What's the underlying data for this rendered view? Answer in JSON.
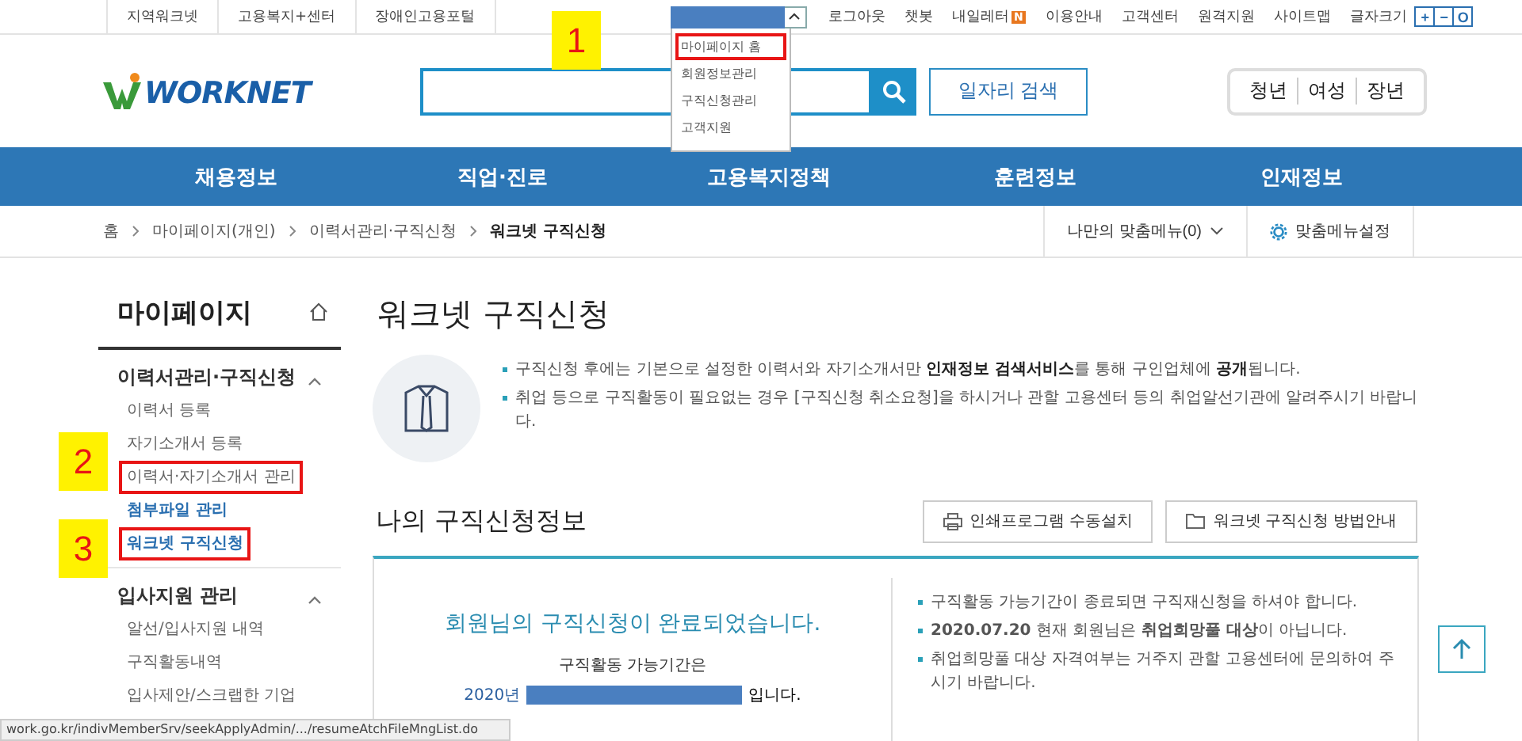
{
  "utility_bar": {
    "left_links": [
      "지역워크넷",
      "고용복지+센터",
      "장애인고용포털"
    ],
    "account_menu": {
      "expanded": true,
      "items": [
        {
          "label": "마이페이지 홈",
          "highlighted": true
        },
        {
          "label": "회원정보관리",
          "highlighted": false
        },
        {
          "label": "구직신청관리",
          "highlighted": false
        },
        {
          "label": "고객지원",
          "highlighted": false
        }
      ]
    },
    "right_links": [
      {
        "label": "로그아웃"
      },
      {
        "label": "챗봇"
      },
      {
        "label": "내일레터",
        "badge": "N"
      },
      {
        "label": "이용안내"
      },
      {
        "label": "고객센터"
      },
      {
        "label": "원격지원"
      },
      {
        "label": "사이트맵"
      }
    ],
    "font_size_label": "글자크기",
    "font_size_buttons": [
      "+",
      "−",
      "O"
    ]
  },
  "header": {
    "logo": "WORKNET",
    "search_button": "일자리 검색",
    "audience_links": [
      "청년",
      "여성",
      "장년"
    ]
  },
  "main_nav": [
    "채용정보",
    "직업·진로",
    "고용복지정책",
    "훈련정보",
    "인재정보"
  ],
  "breadcrumb": {
    "items": [
      "홈",
      "마이페이지(개인)",
      "이력서관리·구직신청",
      "워크넷 구직신청"
    ],
    "my_menu": "나만의 맞춤메뉴(0)",
    "menu_settings": "맞춤메뉴설정"
  },
  "sidebar": {
    "title": "마이페이지",
    "sections": [
      {
        "title": "이력서관리·구직신청",
        "expanded": true,
        "items": [
          {
            "label": "이력서 등록",
            "selected": false,
            "highlighted": false
          },
          {
            "label": "자기소개서 등록",
            "selected": false,
            "highlighted": false
          },
          {
            "label": "이력서·자기소개서 관리",
            "selected": false,
            "highlighted": true
          },
          {
            "label": "첨부파일 관리",
            "selected": true,
            "highlighted": false
          },
          {
            "label": "워크넷 구직신청",
            "selected": true,
            "highlighted": true
          }
        ]
      },
      {
        "title": "입사지원 관리",
        "expanded": true,
        "items": [
          {
            "label": "알선/입사지원 내역",
            "selected": false,
            "highlighted": false
          },
          {
            "label": "구직활동내역",
            "selected": false,
            "highlighted": false
          },
          {
            "label": "입사제안/스크랩한 기업",
            "selected": false,
            "highlighted": false
          }
        ]
      }
    ]
  },
  "page_title": "워크넷 구직신청",
  "notices": [
    "구직신청 후에는 기본으로 설정한 이력서와 자기소개서만 **인재정보 검색서비스**를 통해 구인업체에 **공개**됩니다.",
    "취업 등으로 구직활동이 필요없는 경우 [구직신청 취소요청]을 하시거나 관할 고용센터 등의 취업알선기관에 알려주시기 바랍니다."
  ],
  "status_section": {
    "title": "나의 구직신청정보",
    "buttons": [
      {
        "kind": "print",
        "label": "인쇄프로그램 수동설치"
      },
      {
        "kind": "folder",
        "label": "워크넷 구직신청 방법안내"
      }
    ],
    "complete_message": "회원님의 구직신청이 완료되었습니다.",
    "period_label": "구직활동 가능기간은",
    "period_prefix": "2020년",
    "period_suffix": "입니다.",
    "guides": [
      "구직활동 가능기간이 종료되면 구직재신청을 하셔야 합니다.",
      "**2020.07.20** 현재 회원님은 **취업희망풀 대상**이 아닙니다.",
      "취업희망풀 대상 자격여부는 거주지 관할 고용센터에 문의하여 주시기 바랍니다."
    ]
  },
  "status_bar": "work.go.kr/indivMemberSrv/seekApplyAdmin/.../resumeAtchFileMngList.do",
  "annotations": [
    "1",
    "2",
    "3"
  ]
}
